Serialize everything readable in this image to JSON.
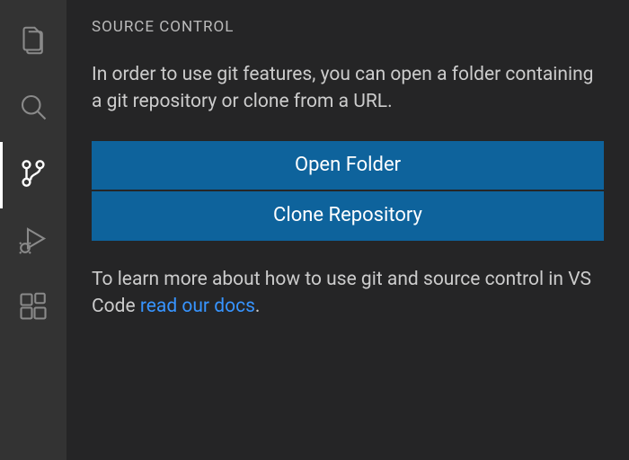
{
  "activityBar": {
    "items": [
      {
        "name": "explorer",
        "active": false
      },
      {
        "name": "search",
        "active": false
      },
      {
        "name": "source-control",
        "active": true
      },
      {
        "name": "run-debug",
        "active": false
      },
      {
        "name": "extensions",
        "active": false
      }
    ]
  },
  "sidebar": {
    "title": "SOURCE CONTROL"
  },
  "welcome": {
    "intro": "In order to use git features, you can open a folder containing a git repository or clone from a URL.",
    "openFolderLabel": "Open Folder",
    "cloneRepoLabel": "Clone Repository",
    "learnMorePrefix": "To learn more about how to use git and source control in VS Code ",
    "learnMoreLink": "read our docs",
    "learnMoreSuffix": "."
  }
}
